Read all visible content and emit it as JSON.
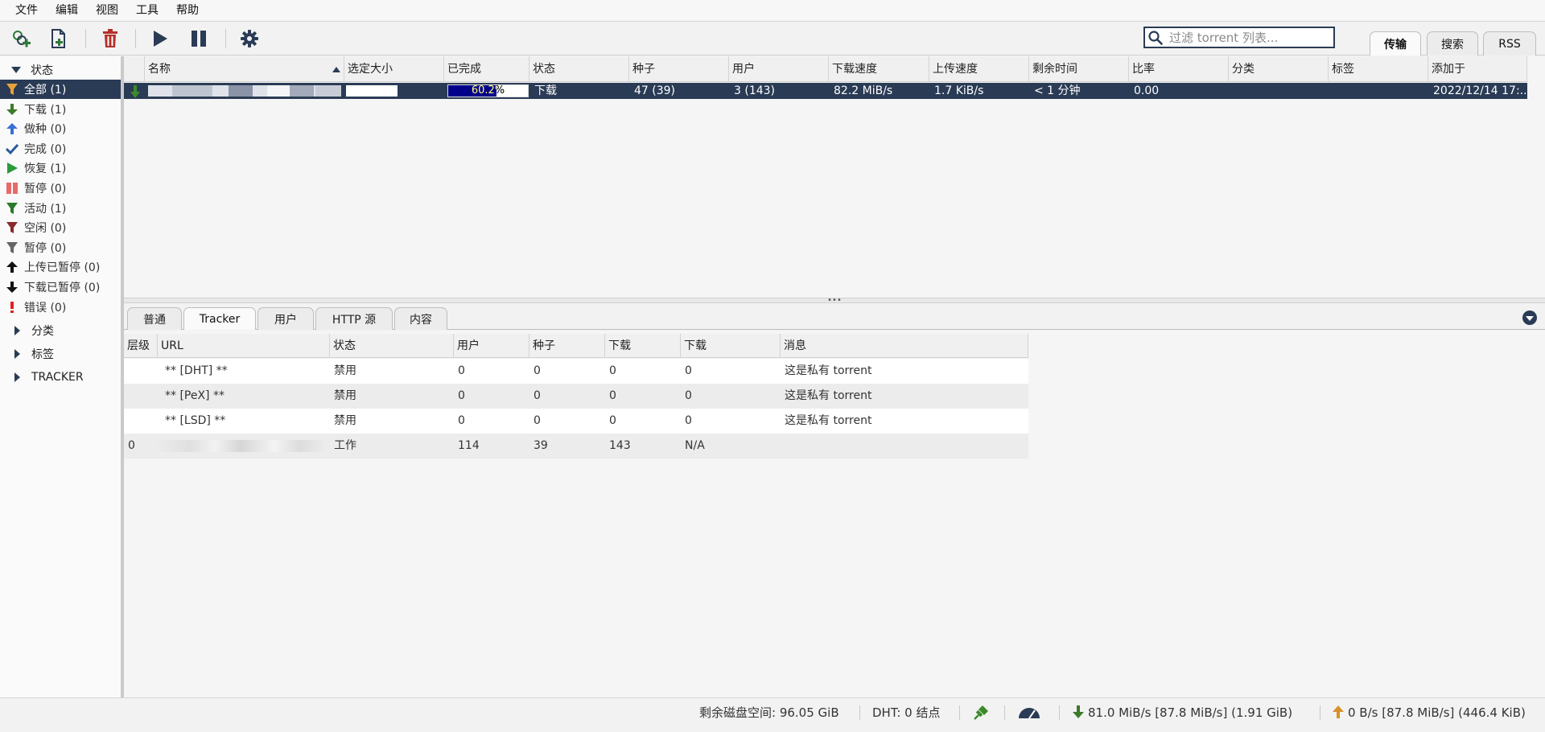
{
  "menu": [
    "文件",
    "编辑",
    "视图",
    "工具",
    "帮助"
  ],
  "toolbar": {
    "search_placeholder": "过滤 torrent 列表...",
    "tabs": [
      "传输",
      "搜索",
      "RSS"
    ]
  },
  "sidebar": {
    "status_header": "状态",
    "items": [
      {
        "label": "全部 (1)",
        "icon": "filter-icon",
        "color": "#e8a23a"
      },
      {
        "label": "下载 (1)",
        "icon": "down-arrow-icon",
        "color": "#3c7a2a"
      },
      {
        "label": "做种 (0)",
        "icon": "up-arrow-icon",
        "color": "#3a6fd8"
      },
      {
        "label": "完成 (0)",
        "icon": "checkmark-icon",
        "color": "#2a5a9a"
      },
      {
        "label": "恢复 (1)",
        "icon": "play-icon",
        "color": "#2a9a3a"
      },
      {
        "label": "暂停 (0)",
        "icon": "pause-icon",
        "color": "#e66a6a"
      },
      {
        "label": "活动 (1)",
        "icon": "filter-icon",
        "color": "#2a7a2a"
      },
      {
        "label": "空闲 (0)",
        "icon": "filter-icon",
        "color": "#8a2a2a"
      },
      {
        "label": "暂停 (0)",
        "icon": "filter-icon",
        "color": "#666666"
      },
      {
        "label": "上传已暂停 (0)",
        "icon": "up-arrow-icon",
        "color": "#111111"
      },
      {
        "label": "下载已暂停 (0)",
        "icon": "down-arrow-icon",
        "color": "#111111"
      },
      {
        "label": "错误 (0)",
        "icon": "exclamation-icon",
        "color": "#e02020"
      }
    ],
    "category_header": "分类",
    "tag_header": "标签",
    "tracker_header": "TRACKER"
  },
  "torrent_table": {
    "columns": [
      "名称",
      "选定大小",
      "已完成",
      "状态",
      "种子",
      "用户",
      "下载速度",
      "上传速度",
      "剩余时间",
      "比率",
      "分类",
      "标签",
      "添加于"
    ],
    "row": {
      "progress": 0.602,
      "progress_text": "60.2%",
      "status": "下载",
      "seeds": "47 (39)",
      "peers": "3 (143)",
      "down_speed": "82.2 MiB/s",
      "up_speed": "1.7 KiB/s",
      "eta": "< 1 分钟",
      "ratio": "0.00",
      "category": "",
      "tags": "",
      "added": "2022/12/14 17:..."
    }
  },
  "detail_tabs": [
    "普通",
    "Tracker",
    "用户",
    "HTTP 源",
    "内容"
  ],
  "tracker_table": {
    "columns": [
      "层级",
      "URL",
      "状态",
      "用户",
      "种子",
      "下载",
      "下载",
      "消息"
    ],
    "rows": [
      {
        "tier": "",
        "url": "** [DHT] **",
        "status": "禁用",
        "peers": "0",
        "seeds": "0",
        "leeches": "0",
        "downloaded": "0",
        "message": "这是私有 torrent"
      },
      {
        "tier": "",
        "url": "** [PeX] **",
        "status": "禁用",
        "peers": "0",
        "seeds": "0",
        "leeches": "0",
        "downloaded": "0",
        "message": "这是私有 torrent"
      },
      {
        "tier": "",
        "url": "** [LSD] **",
        "status": "禁用",
        "peers": "0",
        "seeds": "0",
        "leeches": "0",
        "downloaded": "0",
        "message": "这是私有 torrent"
      },
      {
        "tier": "0",
        "url": "",
        "status": "工作",
        "peers": "114",
        "seeds": "39",
        "leeches": "143",
        "downloaded": "N/A",
        "message": ""
      }
    ]
  },
  "statusbar": {
    "disk_space": "剩余磁盘空间: 96.05 GiB",
    "dht": "DHT: 0 结点",
    "download": "81.0 MiB/s [87.8 MiB/s] (1.91 GiB)",
    "upload": "0 B/s [87.8 MiB/s] (446.4 KiB)"
  },
  "colors": {
    "accent": "#2a3b55",
    "progress": "#00008b"
  }
}
